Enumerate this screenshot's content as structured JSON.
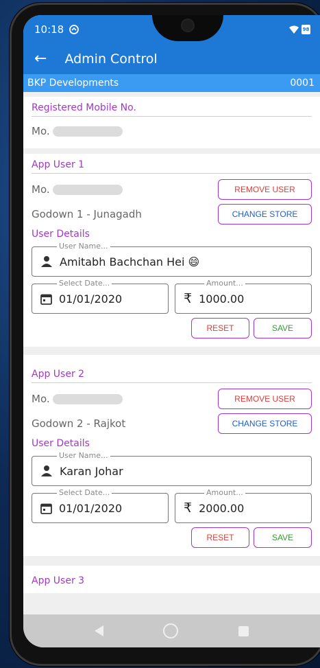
{
  "status": {
    "time": "10:18",
    "battery": "98"
  },
  "appbar": {
    "title": "Admin Control"
  },
  "company": {
    "name": "BKP Developments",
    "code": "0001"
  },
  "registered": {
    "title": "Registered Mobile No.",
    "mo_label": "Mo."
  },
  "users": [
    {
      "title": "App User 1",
      "mo_label": "Mo.",
      "remove_label": "REMOVE USER",
      "store": "Godown 1 - Junagadh",
      "change_store_label": "CHANGE STORE",
      "details_label": "User Details",
      "name_legend": "User Name...",
      "name_value": "Amitabh Bachchan Hei 😄",
      "date_legend": "Select Date...",
      "date_value": "01/01/2020",
      "amount_legend": "Amount...",
      "amount_value": "1000.00",
      "reset_label": "RESET",
      "save_label": "SAVE"
    },
    {
      "title": "App User 2",
      "mo_label": "Mo.",
      "remove_label": "REMOVE USER",
      "store": "Godown 2 - Rajkot",
      "change_store_label": "CHANGE STORE",
      "details_label": "User Details",
      "name_legend": "User Name...",
      "name_value": "Karan Johar",
      "date_legend": "Select Date...",
      "date_value": "01/01/2020",
      "amount_legend": "Amount...",
      "amount_value": "2000.00",
      "reset_label": "RESET",
      "save_label": "SAVE"
    },
    {
      "title": "App User 3"
    }
  ],
  "currency_symbol": "₹",
  "colors": {
    "primary": "#1e78d6",
    "company_bar": "#3b9bf2",
    "accent": "#a437c9",
    "danger": "#e53935",
    "link": "#1e5fc9",
    "success": "#2e9e2e"
  }
}
